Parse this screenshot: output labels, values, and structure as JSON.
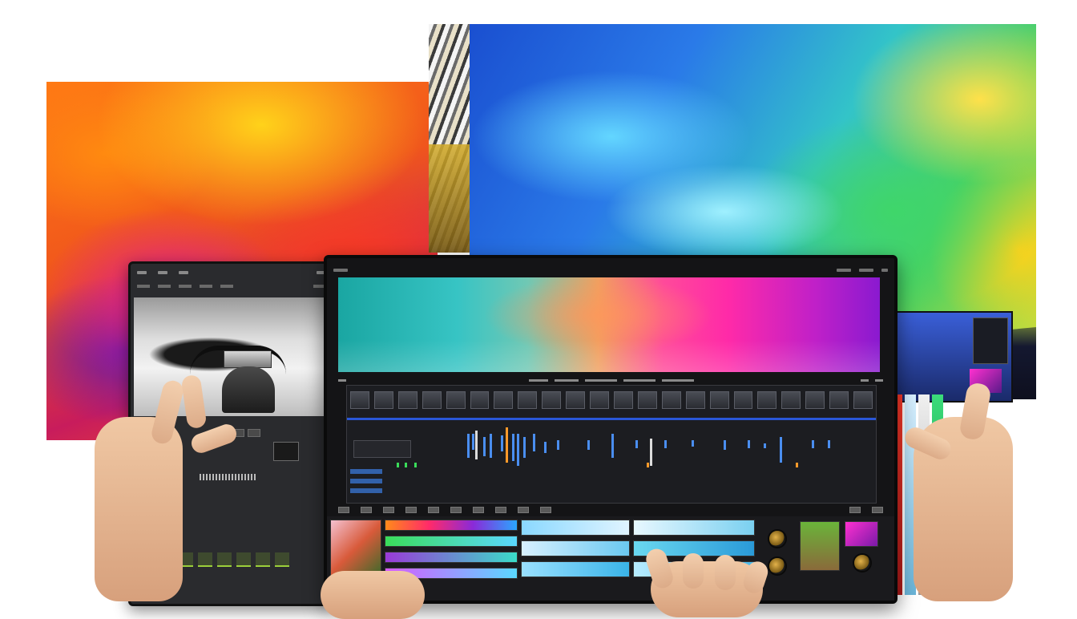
{
  "scene": {
    "description_label": "",
    "laptop_app_title": "",
    "accent_colors": {
      "timeline_blue": "#4a8ef0",
      "playhead": "#2a57d8",
      "marker_orange": "#ff9a2a",
      "marker_green": "#3adc5a"
    }
  },
  "icons": {
    "tablet": "photo-editing-tablet",
    "laptop": "video-editing-laptop",
    "knob": "control-knob-icon"
  }
}
